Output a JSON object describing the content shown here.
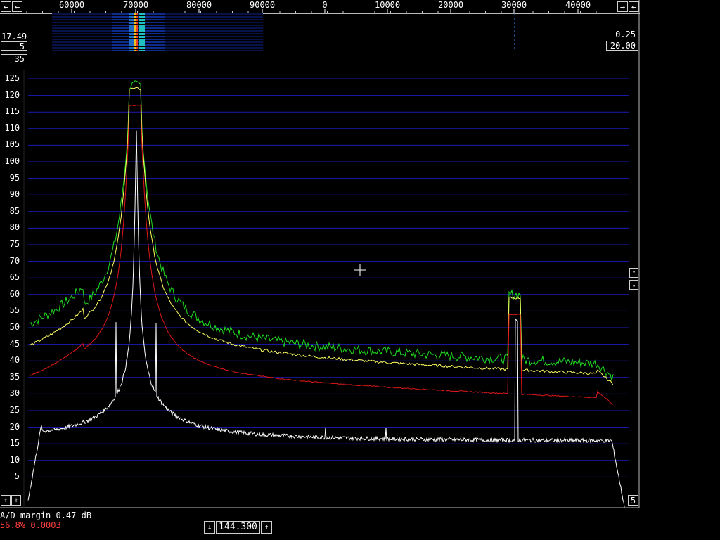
{
  "window": {
    "title": ""
  },
  "frequency_scale": {
    "labels": [
      "60000",
      "70000",
      "80000",
      "90000",
      "0",
      "10000",
      "20000",
      "30000",
      "40000"
    ],
    "left_button": "←",
    "left_button2": "←",
    "right_button": "→",
    "right_button2": "←"
  },
  "waterfall_controls": {
    "avg_label": "17.49",
    "gain_value": "5",
    "zero_value": "35",
    "right_top_value": "0.25",
    "right_bottom_value": "20.00"
  },
  "spectrum": {
    "y_ticks": [
      "125",
      "120",
      "115",
      "110",
      "105",
      "100",
      "95",
      "90",
      "85",
      "80",
      "75",
      "70",
      "65",
      "60",
      "55",
      "50",
      "45",
      "40",
      "35",
      "30",
      "25",
      "20",
      "15",
      "10",
      "5"
    ],
    "right_up_icon": "up-arrow-icon",
    "right_down_icon": "down-arrow-icon",
    "bottom_right_value": "5",
    "bottom_left_icon1": "up-arrow-icon",
    "bottom_left_icon2": "up-arrow-icon"
  },
  "status": {
    "ad_margin": "A/D margin 0.47 dB",
    "stats": "56.8% 0.0003",
    "stats_color": "#ff4040"
  },
  "frequency_box": {
    "value": "144.300",
    "down_icon": "down-arrow-icon",
    "up_icon": "up-arrow-icon"
  },
  "colors": {
    "grid": "#1c1cb4",
    "trace_green": "#20e020",
    "trace_yellow": "#ffff60",
    "trace_red": "#e01818",
    "trace_white": "#ffffff"
  }
}
